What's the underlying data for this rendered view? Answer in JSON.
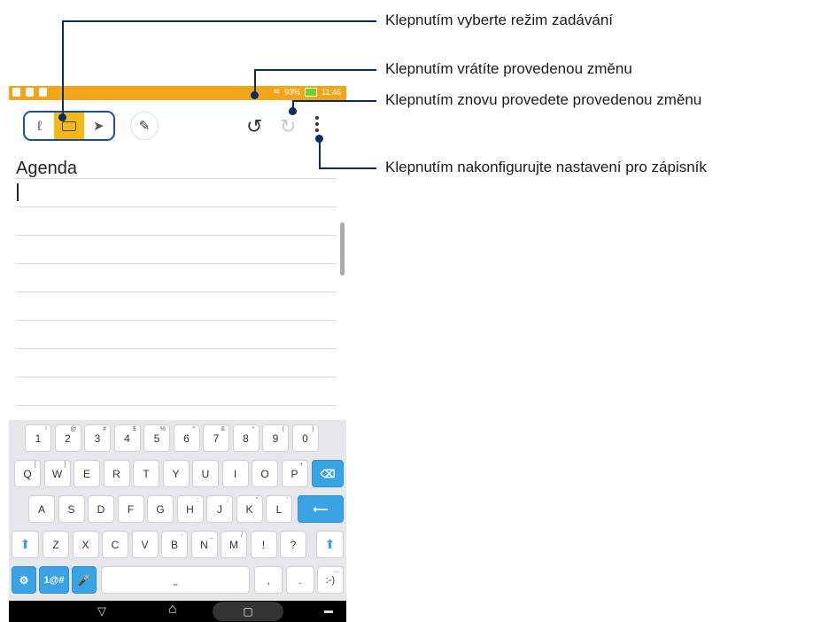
{
  "status_bar": {
    "battery": "93%",
    "time": "11:46"
  },
  "toolbar": {
    "modes": [
      {
        "name": "handwriting-mode",
        "glyph": "ℓ"
      },
      {
        "name": "keyboard-mode",
        "glyph": ""
      },
      {
        "name": "pen-mode",
        "glyph": "➤"
      }
    ],
    "undo_glyph": "↺",
    "redo_glyph": "↻",
    "pen_style_glyph": "✎"
  },
  "note": {
    "title": "Agenda"
  },
  "keyboard": {
    "row1": [
      [
        "1",
        "!"
      ],
      [
        "2",
        "@"
      ],
      [
        "3",
        "#"
      ],
      [
        "4",
        "$"
      ],
      [
        "5",
        "%"
      ],
      [
        "6",
        "^"
      ],
      [
        "7",
        "&"
      ],
      [
        "8",
        "*"
      ],
      [
        "9",
        "("
      ],
      [
        "0",
        ")"
      ]
    ],
    "row2": [
      [
        "Q",
        "["
      ],
      [
        "W",
        "]"
      ],
      [
        "E",
        ""
      ],
      [
        "R",
        ""
      ],
      [
        "T",
        ""
      ],
      [
        "Y",
        ""
      ],
      [
        "U",
        ""
      ],
      [
        "I",
        ""
      ],
      [
        "O",
        ""
      ],
      [
        "P",
        "+"
      ]
    ],
    "row3": [
      [
        "A",
        ""
      ],
      [
        "S",
        ""
      ],
      [
        "D",
        ""
      ],
      [
        "F",
        ""
      ],
      [
        "G",
        ""
      ],
      [
        "H",
        ":"
      ],
      [
        "J",
        ";"
      ],
      [
        "K",
        "\""
      ],
      [
        "L",
        "'"
      ]
    ],
    "row4": [
      [
        "Z",
        ""
      ],
      [
        "X",
        ""
      ],
      [
        "C",
        ""
      ],
      [
        "V",
        ""
      ],
      [
        "B",
        "-"
      ],
      [
        "N",
        "_"
      ],
      [
        "M",
        "/"
      ],
      [
        "!",
        ""
      ],
      [
        "?",
        ""
      ]
    ],
    "backspace": "⌫",
    "enter": "⟵",
    "shift": "⬆",
    "settings": "⚙",
    "symbols": "1@#",
    "mic": "🎤",
    "space": "⎵",
    "comma": ",",
    "period": ".",
    "smiley": ":-)",
    "smiley_sup": "…"
  },
  "nav": {
    "back": "▽",
    "home": "⌂",
    "recent": "▢",
    "kbd": "▬"
  },
  "callouts": [
    "Klepnutím vyberte režim zadávání",
    "Klepnutím vrátíte provedenou změnu",
    "Klepnutím znovu provedete provedenou změnu",
    "Klepnutím nakonfigurujte nastavení pro zápisník"
  ],
  "colors": {
    "status_bar": "#f3a51a",
    "accent": "#f5b915",
    "callout": "#0a2b63",
    "key_blue": "#3aa3e3"
  }
}
